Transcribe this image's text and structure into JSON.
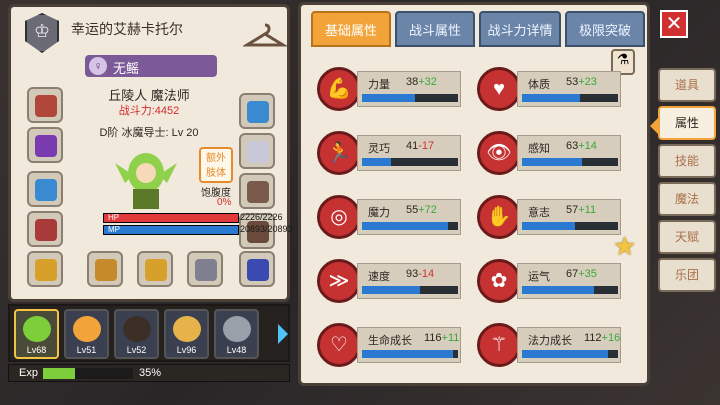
{
  "character": {
    "name": "幸运的艾赫卡托尔",
    "title": "无鳐",
    "class_line": "丘陵人 魔法师",
    "power": "战斗力:4452",
    "level_line": "D阶 冰魔导士: Lv 20",
    "extra_body": [
      "额外",
      "肢体"
    ],
    "hunger_label": "饱腹度",
    "hunger_value": "0%",
    "hp_label": "HP",
    "hp_value": "2226/2226",
    "hp_fraction": 1.0,
    "mp_label": "MP",
    "mp_value": "20893/20893",
    "mp_fraction": 1.0
  },
  "party": [
    {
      "lv": "Lv68",
      "color": "#7ccf3a",
      "active": true
    },
    {
      "lv": "Lv51",
      "color": "#f2a43a",
      "active": false
    },
    {
      "lv": "Lv52",
      "color": "#3a2e26",
      "active": false
    },
    {
      "lv": "Lv96",
      "color": "#e6b34a",
      "active": false
    },
    {
      "lv": "Lv48",
      "color": "#9aa0aa",
      "active": false
    }
  ],
  "exp": {
    "label": "Exp",
    "value": "35%",
    "fraction": 0.35
  },
  "tabs": [
    "基础属性",
    "战斗属性",
    "战斗力详情",
    "极限突破"
  ],
  "stats": [
    {
      "name": "力量",
      "base": "38",
      "bonus": "+32",
      "positive": true,
      "fill": 0.55,
      "icon": "strength-icon"
    },
    {
      "name": "体质",
      "base": "53",
      "bonus": "+23",
      "positive": true,
      "fill": 0.6,
      "icon": "constitution-icon"
    },
    {
      "name": "灵巧",
      "base": "41",
      "bonus": "-17",
      "positive": false,
      "fill": 0.3,
      "icon": "agility-icon"
    },
    {
      "name": "感知",
      "base": "63",
      "bonus": "+14",
      "positive": true,
      "fill": 0.62,
      "icon": "perception-icon"
    },
    {
      "name": "魔力",
      "base": "55",
      "bonus": "+72",
      "positive": true,
      "fill": 0.9,
      "icon": "magic-icon"
    },
    {
      "name": "意志",
      "base": "57",
      "bonus": "+11",
      "positive": true,
      "fill": 0.55,
      "icon": "will-icon"
    },
    {
      "name": "速度",
      "base": "93",
      "bonus": "-14",
      "positive": false,
      "fill": 0.6,
      "icon": "speed-icon"
    },
    {
      "name": "运气",
      "base": "67",
      "bonus": "+35",
      "positive": true,
      "fill": 0.75,
      "icon": "luck-icon"
    },
    {
      "name": "生命成长",
      "base": "116",
      "bonus": "+11",
      "positive": true,
      "fill": 0.95,
      "icon": "life-growth-icon"
    },
    {
      "name": "法力成长",
      "base": "112",
      "bonus": "+16",
      "positive": true,
      "fill": 0.9,
      "icon": "mana-growth-icon"
    }
  ],
  "side_tabs": [
    "道具",
    "属性",
    "技能",
    "魔法",
    "天赋",
    "乐团"
  ],
  "colors": {
    "accent": "#f2a43a",
    "stat_icon": "#c63232",
    "hp": "#e23a3a",
    "mp": "#2b7ad1"
  }
}
